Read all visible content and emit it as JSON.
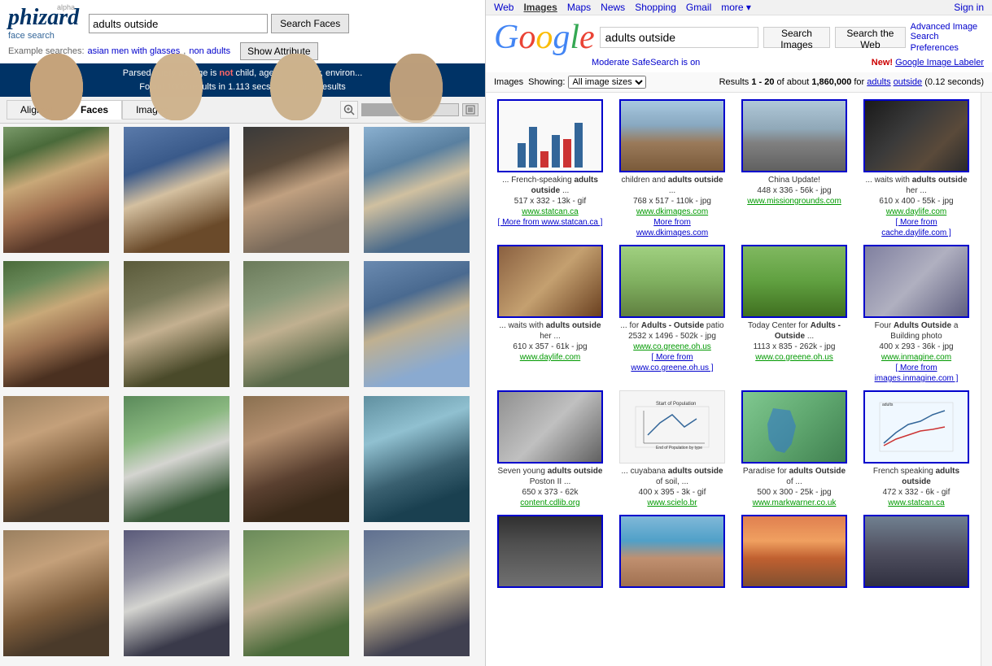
{
  "left": {
    "logo": {
      "main": "phizard",
      "alpha": "alpha",
      "sub": "face search"
    },
    "search": {
      "query": "adults outside",
      "search_btn": "Search Faces",
      "show_attr_btn": "Show Attribute",
      "examples_label": "Example searches:",
      "example1": "asian men with glasses",
      "example2": "non adults"
    },
    "parsed": {
      "line1": "Parsed query as: age is not child, age is not baby, environ...",
      "line2": "Found 1000 results in 1.113 secs. Displaying results"
    },
    "tabs": {
      "aligned": "Aligned",
      "faces": "Faces",
      "images": "Images"
    },
    "faces": [
      {
        "id": 1,
        "cls": "face-1"
      },
      {
        "id": 2,
        "cls": "face-2"
      },
      {
        "id": 3,
        "cls": "face-3"
      },
      {
        "id": 4,
        "cls": "face-4"
      },
      {
        "id": 5,
        "cls": "face-5"
      },
      {
        "id": 6,
        "cls": "face-6"
      },
      {
        "id": 7,
        "cls": "face-7"
      },
      {
        "id": 8,
        "cls": "face-8"
      },
      {
        "id": 9,
        "cls": "face-9"
      },
      {
        "id": 10,
        "cls": "face-10"
      },
      {
        "id": 11,
        "cls": "face-11"
      },
      {
        "id": 12,
        "cls": "face-12"
      },
      {
        "id": 13,
        "cls": "face-13"
      },
      {
        "id": 14,
        "cls": "face-14"
      },
      {
        "id": 15,
        "cls": "face-15"
      },
      {
        "id": 16,
        "cls": "face-16"
      }
    ]
  },
  "right": {
    "topbar": {
      "links": [
        "Web",
        "Images",
        "Maps",
        "News",
        "Shopping",
        "Gmail",
        "more ▾"
      ],
      "active": "Images",
      "signin": "Sign in"
    },
    "logo": "Google",
    "search": {
      "query": "adults outside",
      "search_images_btn": "Search Images",
      "search_web_btn": "Search the Web"
    },
    "advanced_link": "Advanced Image Search",
    "preferences_link": "Preferences",
    "new_label": "New!",
    "labeler_link": "Google Image Labeler",
    "safe_search": "Moderate SafeSearch is on",
    "results_header": {
      "showing_label": "Images  Showing:",
      "size_option": "All image sizes",
      "results_range": "Results 1 - 20",
      "about": "of about",
      "count": "1,860,000",
      "query_pre": "for",
      "query_word1": "adults",
      "query_word2": "outside",
      "time": "(0.12 seconds)"
    },
    "images": [
      {
        "id": 1,
        "photo_cls": "photo-chart",
        "caption1": "... French-speaking ",
        "bold": "adults outside",
        "caption2": " ...",
        "size": "517 x 332 - 13k - gif",
        "site": "www.statcan.ca",
        "more": "[ More from www.statcan.ca ]"
      },
      {
        "id": 2,
        "photo_cls": "photo-group",
        "caption1": "children and ",
        "bold": "adults outside",
        "caption2": " ...",
        "size": "768 x 517 - 110k - jpg",
        "site": "www.dkimages.com",
        "more": "More from www.dkimages.com"
      },
      {
        "id": 3,
        "photo_cls": "photo-china",
        "caption1": "China Update!",
        "bold": "",
        "caption2": "",
        "size": "448 x 336 - 56k - jpg",
        "site": "www.missiongrounds.com",
        "more": ""
      },
      {
        "id": 4,
        "photo_cls": "photo-dark",
        "caption1": "... waits with ",
        "bold": "adults outside",
        "caption2": " her ...",
        "size": "610 x 400 - 55k - jpg",
        "site": "www.daylife.com",
        "more": "[ More from cache.daylife.com ]"
      },
      {
        "id": 5,
        "photo_cls": "photo-interior",
        "caption1": "... waits with ",
        "bold": "adults outside",
        "caption2": " her ...",
        "size": "610 x 357 - 61k - jpg",
        "site": "www.daylife.com",
        "more": ""
      },
      {
        "id": 6,
        "photo_cls": "photo-patio",
        "caption1": "... for ",
        "bold": "Adults - Outside",
        "caption2": " patio",
        "size": "2532 x 1496 - 502k - jpg",
        "site": "www.co.greene.oh.us",
        "more": "[ More from www.co.greene.oh.us ]"
      },
      {
        "id": 7,
        "photo_cls": "photo-park",
        "caption1": "Today Center for ",
        "bold": "Adults - Outside",
        "caption2": " ...",
        "size": "1113 x 835 - 262k - jpg",
        "site": "www.co.greene.oh.us",
        "more": ""
      },
      {
        "id": 8,
        "photo_cls": "photo-building",
        "caption1": "Four ",
        "bold": "Adults Outside",
        "caption2": " a Building photo",
        "size": "400 x 293 - 36k - jpg",
        "site": "www.inmagine.com",
        "more": "[ More from images.inmagine.com ]"
      },
      {
        "id": 9,
        "photo_cls": "photo-bw",
        "caption1": "Seven young ",
        "bold": "adults outside",
        "caption2": " Poston II ...",
        "size": "650 x 373 - 62k",
        "site": "content.cdlib.org",
        "more": ""
      },
      {
        "id": 10,
        "photo_cls": "photo-graph",
        "caption1": "... cuyabana ",
        "bold": "adults outside",
        "caption2": " of soil, ...",
        "size": "400 x 395 - 3k - gif",
        "site": "www.scielo.br",
        "more": ""
      },
      {
        "id": 11,
        "photo_cls": "photo-map",
        "caption1": "Paradise for ",
        "bold": "adults Outside",
        "caption2": " of ...",
        "size": "500 x 300 - 25k - jpg",
        "site": "www.markwarner.co.uk",
        "more": ""
      },
      {
        "id": 12,
        "photo_cls": "photo-line",
        "caption1": "French speaking ",
        "bold": "adults outside",
        "caption2": "",
        "size": "472 x 332 - 6k - gif",
        "site": "www.statcan.ca",
        "more": ""
      },
      {
        "id": 13,
        "photo_cls": "photo-hat",
        "caption1": "",
        "bold": "",
        "caption2": "",
        "size": "",
        "site": "",
        "more": ""
      },
      {
        "id": 14,
        "photo_cls": "photo-family",
        "caption1": "",
        "bold": "",
        "caption2": "",
        "size": "",
        "site": "",
        "more": ""
      },
      {
        "id": 15,
        "photo_cls": "photo-sunset",
        "caption1": "",
        "bold": "",
        "caption2": "",
        "size": "",
        "site": "",
        "more": ""
      },
      {
        "id": 16,
        "photo_cls": "photo-volcano",
        "caption1": "",
        "bold": "",
        "caption2": "",
        "size": "",
        "site": "",
        "more": ""
      }
    ]
  }
}
